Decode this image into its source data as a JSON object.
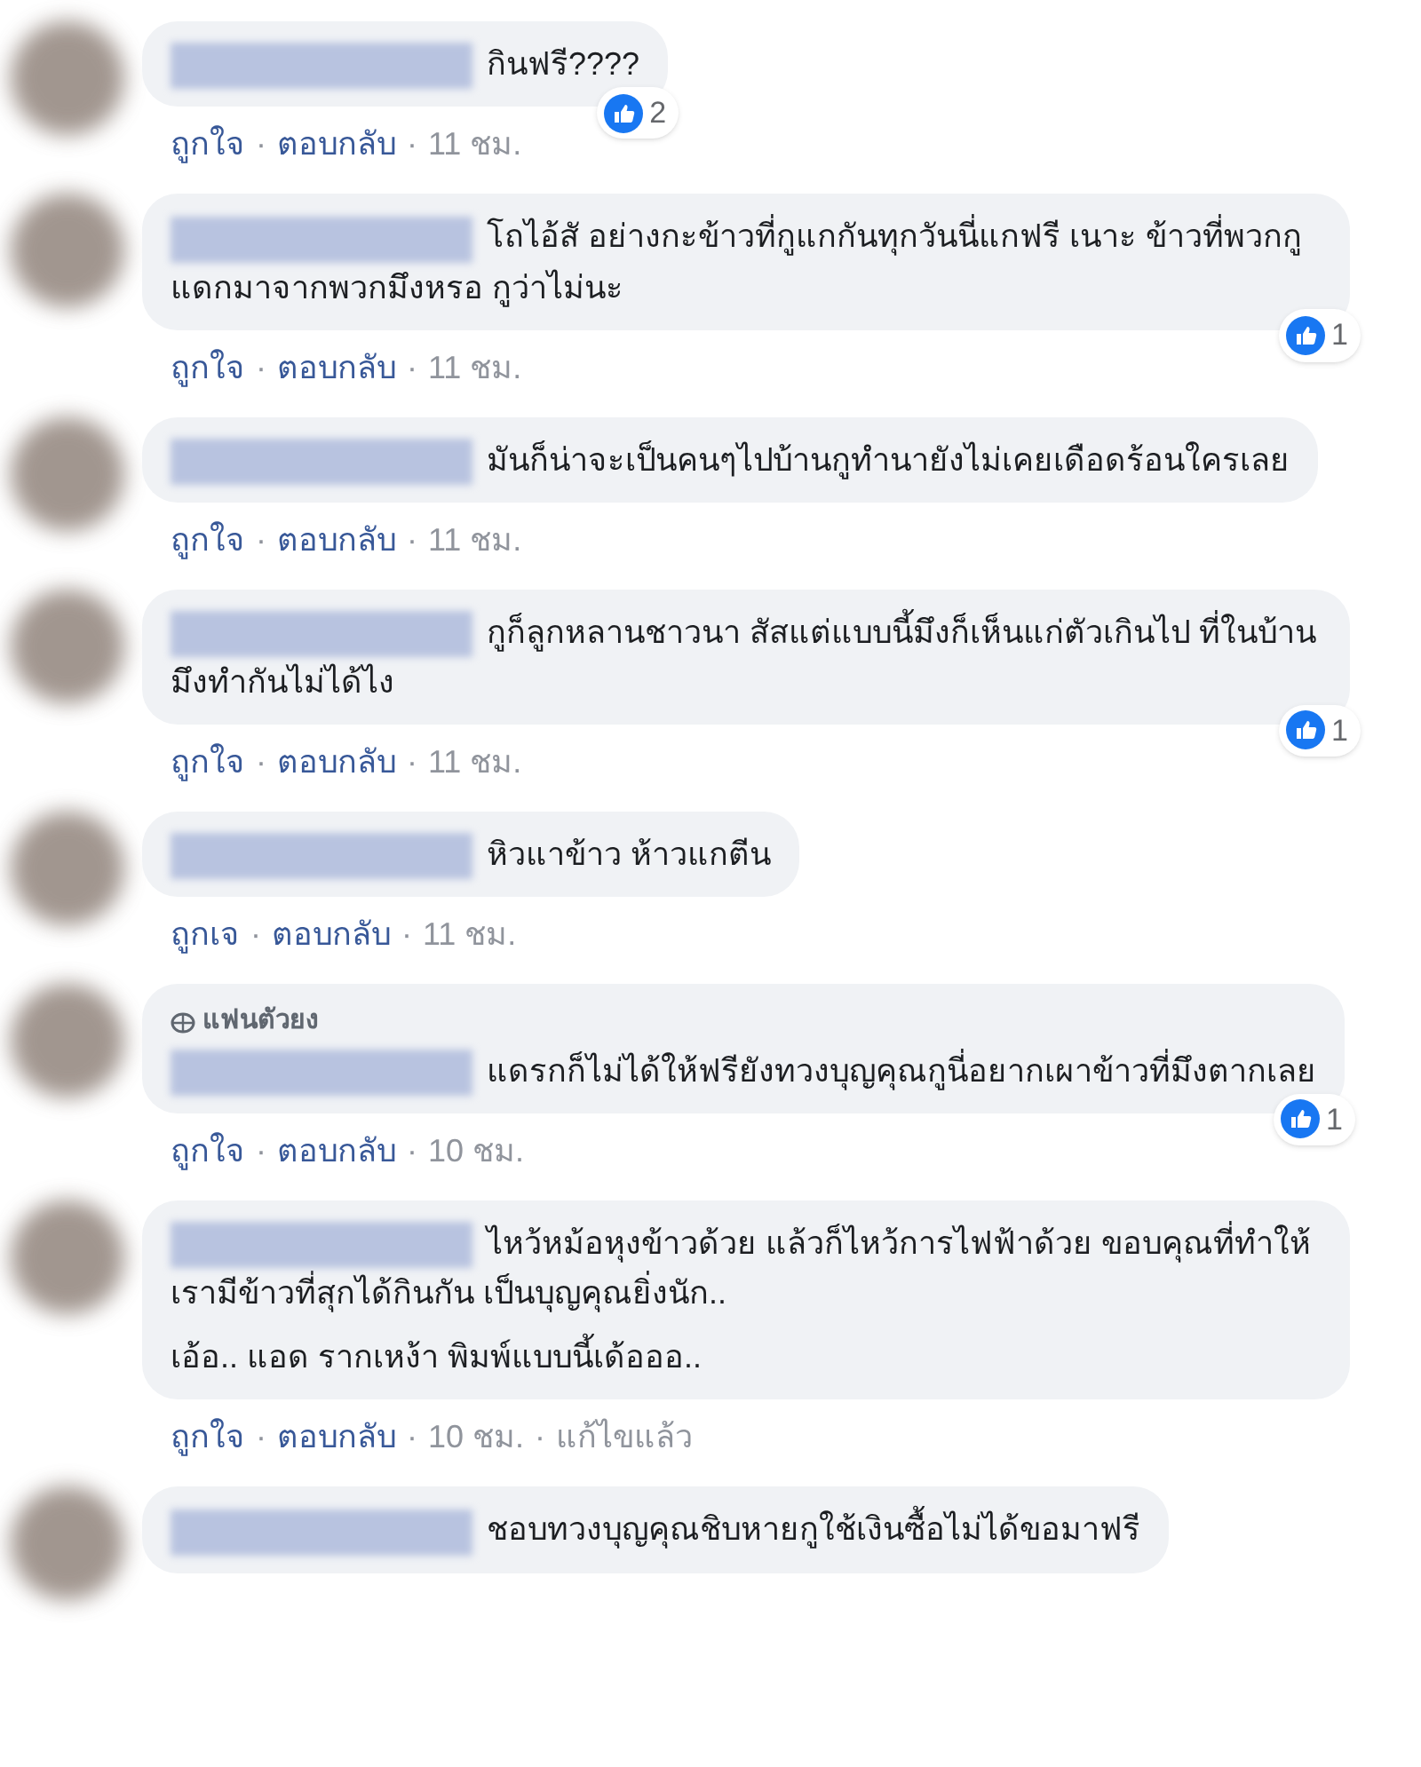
{
  "separator": "·",
  "comments": [
    {
      "paragraphs": [
        "กินฟรี????"
      ],
      "likes": "2",
      "actions": [
        "ถูกใจ",
        "ตอบกลับ"
      ],
      "time": "11 ชม."
    },
    {
      "paragraphs": [
        "โถไอ้สั อย่างกะข้าวที่กูแกกันทุกวันนี่แกฟรี เนาะ ข้าวที่พวกกูแดกมาจากพวกมึงหรอ กูว่าไม่นะ"
      ],
      "likes": "1",
      "actions": [
        "ถูกใจ",
        "ตอบกลับ"
      ],
      "time": "11 ชม."
    },
    {
      "paragraphs": [
        "มันก็น่าจะเป็นคนๆไปบ้านกูทำนายังไม่เคยเดือดร้อนใครเลย"
      ],
      "actions": [
        "ถูกใจ",
        "ตอบกลับ"
      ],
      "time": "11 ชม."
    },
    {
      "paragraphs": [
        "กูก็ลูกหลานชาวนา สัสแต่แบบนี้มึงก็เห็นแก่ตัวเกินไป ที่ในบ้านมึงทำกันไม่ได้ไง"
      ],
      "likes": "1",
      "actions": [
        "ถูกใจ",
        "ตอบกลับ"
      ],
      "time": "11 ชม."
    },
    {
      "paragraphs": [
        "หิวแาข้าว ห้าวแกตีน"
      ],
      "actions": [
        "ถูกเจ",
        "ตอบกลับ"
      ],
      "time": "11 ชม."
    },
    {
      "badge": "แฟนตัวยง",
      "paragraphs": [
        "แดรกก็ไม่ได้ให้ฟรียังทวงบุญคุณกูนี่อยากเผาข้าวที่มึงตากเลย"
      ],
      "likes": "1",
      "actions": [
        "ถูกใจ",
        "ตอบกลับ"
      ],
      "time": "10 ชม."
    },
    {
      "paragraphs": [
        "ไหว้หม้อหุงข้าวด้วย แล้วก็ไหว้การไฟฟ้าด้วย ขอบคุณที่ทำให้เรามีข้าวที่สุกได้กินกัน เป็นบุญคุณยิ่งนัก..",
        "เอ้อ.. แอด รากเหง้า พิมพ์แบบนี้เด้อออ.."
      ],
      "actions": [
        "ถูกใจ",
        "ตอบกลับ"
      ],
      "time": "10 ชม.",
      "edited": "แก้ไขแล้ว"
    },
    {
      "paragraphs": [
        "ชอบทวงบุญคุณชิบหายกูใช้เงินซื้อไม่ได้ขอมาฟรี"
      ]
    }
  ]
}
